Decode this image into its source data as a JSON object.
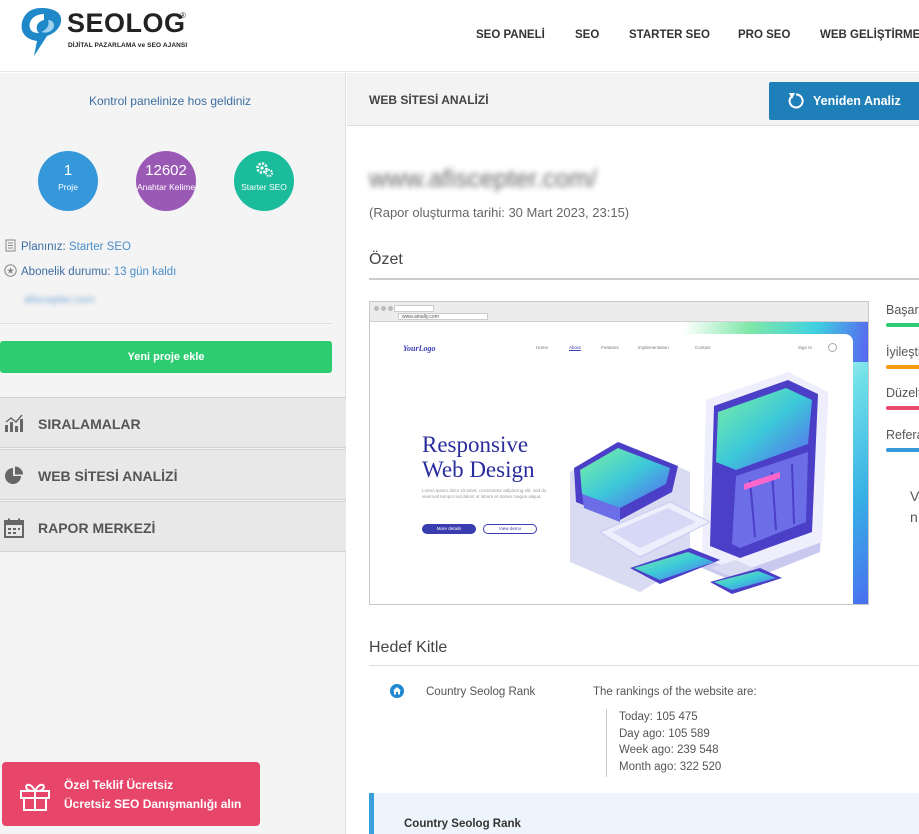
{
  "header": {
    "logo_text": "SEOLOG",
    "logo_reg": "®",
    "logo_tagline": "DİJİTAL PAZARLAMA ve SEO AJANSI",
    "nav": [
      "SEO PANELİ",
      "SEO",
      "STARTER SEO",
      "PRO SEO",
      "WEB GELİŞTİRME"
    ]
  },
  "sidebar": {
    "welcome": "Kontrol panelinize hos geldiniz",
    "stats": [
      {
        "value": "1",
        "label": "Proje",
        "color": "#3498db"
      },
      {
        "value": "12602",
        "label": "Anahtar Kelime",
        "color": "#9b59b6"
      },
      {
        "value": "",
        "label": "Starter SEO",
        "color": "#1abc9c",
        "icon": "gears-icon"
      }
    ],
    "plan_label": "Planınız:",
    "plan_value": "Starter SEO",
    "subscription_label": "Abonelik durumu:",
    "subscription_value": "13 gün kaldı",
    "domain_blurred": "afiscepter.com",
    "new_project": "Yeni proje ekle",
    "menu": [
      {
        "label": "SIRALAMALAR",
        "icon": "bar-chart-icon"
      },
      {
        "label": "WEB SİTESİ ANALİZİ",
        "icon": "pie-chart-icon"
      },
      {
        "label": "RAPOR MERKEZİ",
        "icon": "calendar-icon"
      }
    ],
    "offer": {
      "line1": "Özel Teklif Ücretsiz",
      "line2": "Ücretsiz SEO Danışmanlığı alın",
      "color": "#e8456b",
      "icon": "gift-icon"
    }
  },
  "main": {
    "bar_title": "WEB SİTESİ ANALİZİ",
    "reanalyze": "Yeniden Analiz",
    "site_url": "www.afiscepter.com/",
    "report_date": "(Rapor oluşturma tarihi: 30 Mart 2023, 23:15)",
    "summary_title": "Özet",
    "legend": [
      {
        "label": "Başarılı",
        "color": "#2ecc71"
      },
      {
        "label": "İyileştirme",
        "color": "#f39c12"
      },
      {
        "label": "Düzeltme",
        "color": "#e74c6c"
      },
      {
        "label": "Referans",
        "color": "#3498db"
      }
    ],
    "legend_cut_lines": [
      "V",
      "n"
    ],
    "thumbnail": {
      "url": "www.amally.com",
      "logo": "YourLogo",
      "nav": [
        "Home",
        "About",
        "Features",
        "Implementation",
        "Contact"
      ],
      "signin": "Sign In",
      "headline1": "Responsive",
      "headline2": "Web Design",
      "body": "Lorem ipsum dolor sit amet, consectetur adipiscing elit, sed do eiusmod tempor incididunt ut labore et dolore magna aliqua.",
      "btn1": "More details",
      "btn2": "View demo"
    },
    "audience_title": "Hedef Kitle",
    "country_rank_label": "Country Seolog Rank",
    "rank_intro": "The rankings of the website are:",
    "rank_lines": [
      "Today: 105 475",
      "Day ago: 105 589",
      "Week ago: 239 548",
      "Month ago: 322 520"
    ],
    "country_box_title": "Country Seolog Rank"
  }
}
